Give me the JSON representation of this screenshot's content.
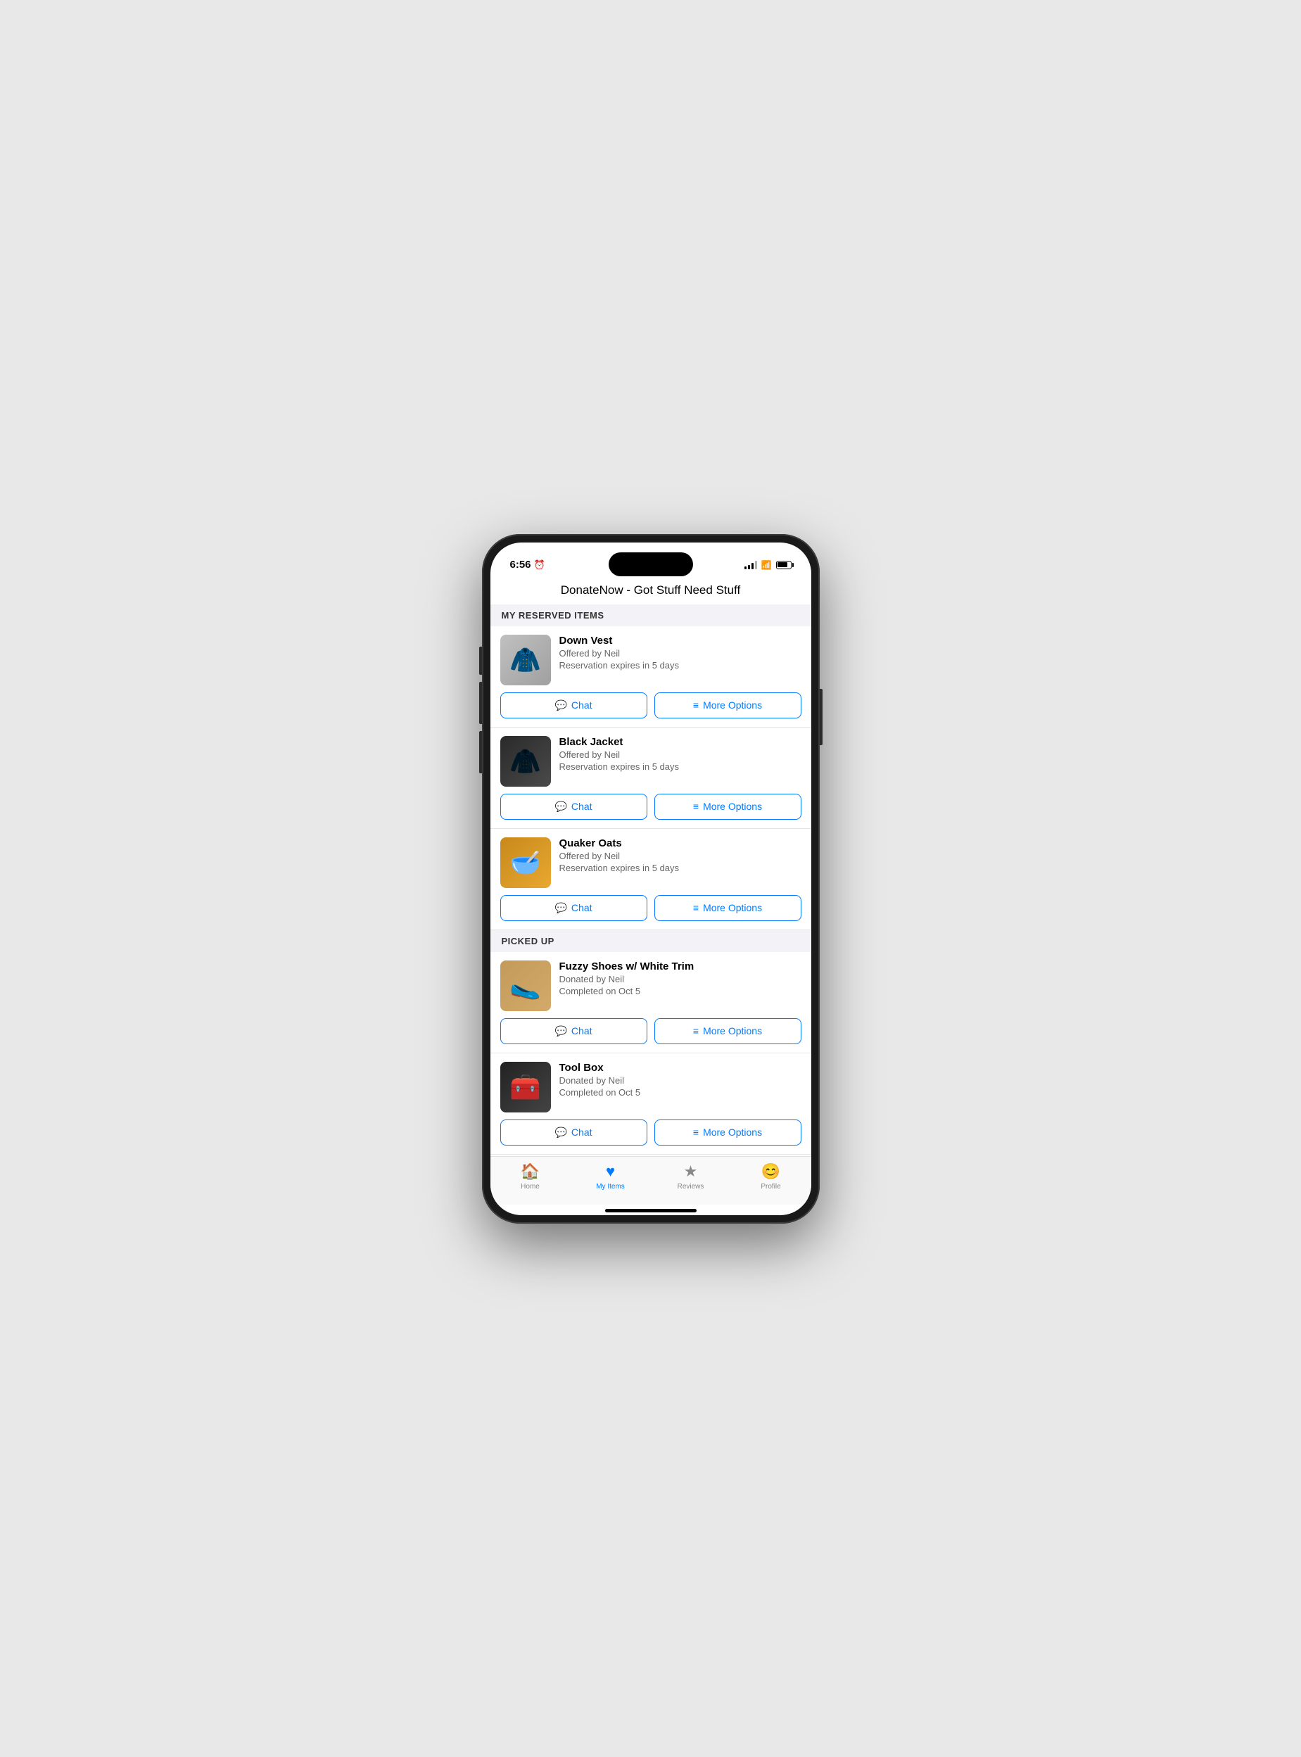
{
  "app": {
    "title": "DonateNow - Got Stuff Need Stuff"
  },
  "statusBar": {
    "time": "6:56",
    "sleepIcon": "⏰"
  },
  "sections": [
    {
      "id": "reserved",
      "header": "MY RESERVED ITEMS",
      "items": [
        {
          "id": "down-vest",
          "name": "Down Vest",
          "offeredBy": "Offered by Neil",
          "status": "Reservation expires in 5 days",
          "imageType": "down-vest",
          "imageEmoji": "🧥",
          "chatLabel": "Chat",
          "moreLabel": "More Options"
        },
        {
          "id": "black-jacket",
          "name": "Black Jacket",
          "offeredBy": "Offered by Neil",
          "status": "Reservation expires in 5 days",
          "imageType": "black-jacket",
          "imageEmoji": "🧥",
          "chatLabel": "Chat",
          "moreLabel": "More Options"
        },
        {
          "id": "quaker-oats",
          "name": "Quaker Oats",
          "offeredBy": "Offered by Neil",
          "status": "Reservation expires in 5 days",
          "imageType": "quaker-oats",
          "imageEmoji": "🥣",
          "chatLabel": "Chat",
          "moreLabel": "More Options"
        }
      ]
    },
    {
      "id": "picked-up",
      "header": "PICKED UP",
      "items": [
        {
          "id": "fuzzy-shoes",
          "name": "Fuzzy Shoes w/ White Trim",
          "offeredBy": "Donated by Neil",
          "status": "Completed on Oct 5",
          "imageType": "fuzzy-shoes",
          "imageEmoji": "🥿",
          "chatLabel": "Chat",
          "moreLabel": "More Options"
        },
        {
          "id": "tool-box",
          "name": "Tool Box",
          "offeredBy": "Donated by Neil",
          "status": "Completed on Oct 5",
          "imageType": "tool-box",
          "imageEmoji": "🧰",
          "chatLabel": "Chat",
          "moreLabel": "More Options"
        }
      ]
    }
  ],
  "tabBar": {
    "tabs": [
      {
        "id": "home",
        "label": "Home",
        "icon": "🏠",
        "active": false
      },
      {
        "id": "my-items",
        "label": "My Items",
        "icon": "♥",
        "active": true
      },
      {
        "id": "reviews",
        "label": "Reviews",
        "icon": "★",
        "active": false
      },
      {
        "id": "profile",
        "label": "Profile",
        "icon": "😊",
        "active": false
      }
    ]
  },
  "icons": {
    "chat": "💬",
    "more": "≡"
  }
}
